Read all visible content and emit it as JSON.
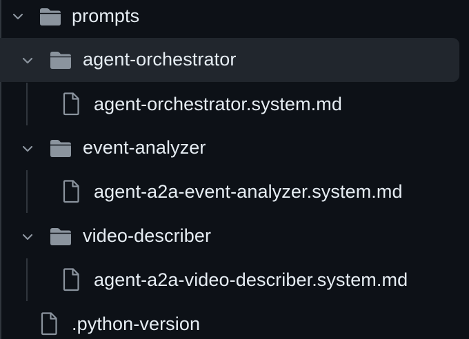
{
  "tree": {
    "root_folder": {
      "label": "prompts",
      "expanded": true
    },
    "folders": [
      {
        "label": "agent-orchestrator",
        "expanded": true,
        "selected": true,
        "files": [
          {
            "label": "agent-orchestrator.system.md"
          }
        ]
      },
      {
        "label": "event-analyzer",
        "expanded": true,
        "selected": false,
        "files": [
          {
            "label": "agent-a2a-event-analyzer.system.md"
          }
        ]
      },
      {
        "label": "video-describer",
        "expanded": true,
        "selected": false,
        "files": [
          {
            "label": "agent-a2a-video-describer.system.md"
          }
        ]
      }
    ],
    "sibling_files": [
      {
        "label": ".python-version"
      }
    ]
  },
  "colors": {
    "background": "#0d1117",
    "text": "#e6edf3",
    "icon": "#8b949e",
    "selected_row": "#21262d",
    "guide_line": "#30363d"
  },
  "icons": {
    "chevron": "chevron-down-icon",
    "folder": "folder-icon",
    "file": "file-icon"
  }
}
